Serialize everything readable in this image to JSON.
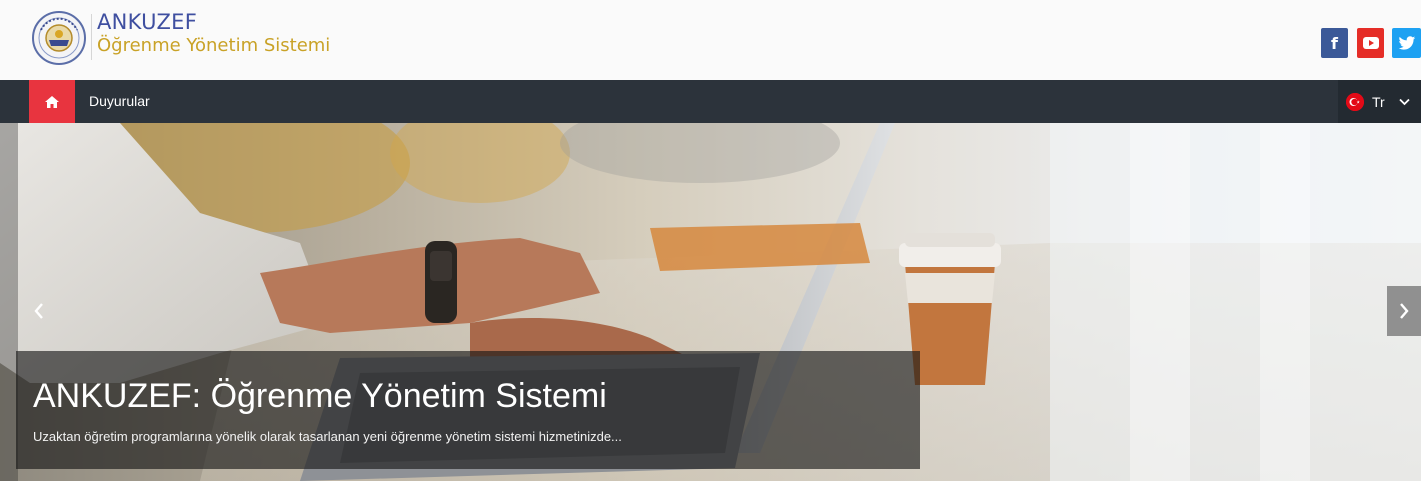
{
  "header": {
    "brand_title": "ANKUZEF",
    "brand_subtitle": "Öğrenme Yönetim Sistemi",
    "logo_icon": "university-seal-icon",
    "social": [
      {
        "name": "facebook-icon",
        "glyph": "f",
        "color": "#3b5998"
      },
      {
        "name": "youtube-icon",
        "glyph": "▶",
        "color": "#e52d27"
      },
      {
        "name": "twitter-icon",
        "glyph": "t",
        "color": "#1da1f2"
      }
    ]
  },
  "navbar": {
    "home_icon": "home-icon",
    "links": [
      "Duyurular"
    ],
    "language": {
      "label": "Tr",
      "flag_icon": "turkey-flag-icon",
      "chevron_icon": "chevron-down-icon"
    },
    "background": "#2c333b",
    "home_accent": "#e8343f"
  },
  "hero": {
    "title": "ANKUZEF: Öğrenme Yönetim Sistemi",
    "description": "Uzaktan öğretim programlarına yönelik olarak tasarlanan yeni öğrenme yönetim sistemi hizmetinizde...",
    "prev_icon": "chevron-left-icon",
    "next_icon": "chevron-right-icon"
  }
}
